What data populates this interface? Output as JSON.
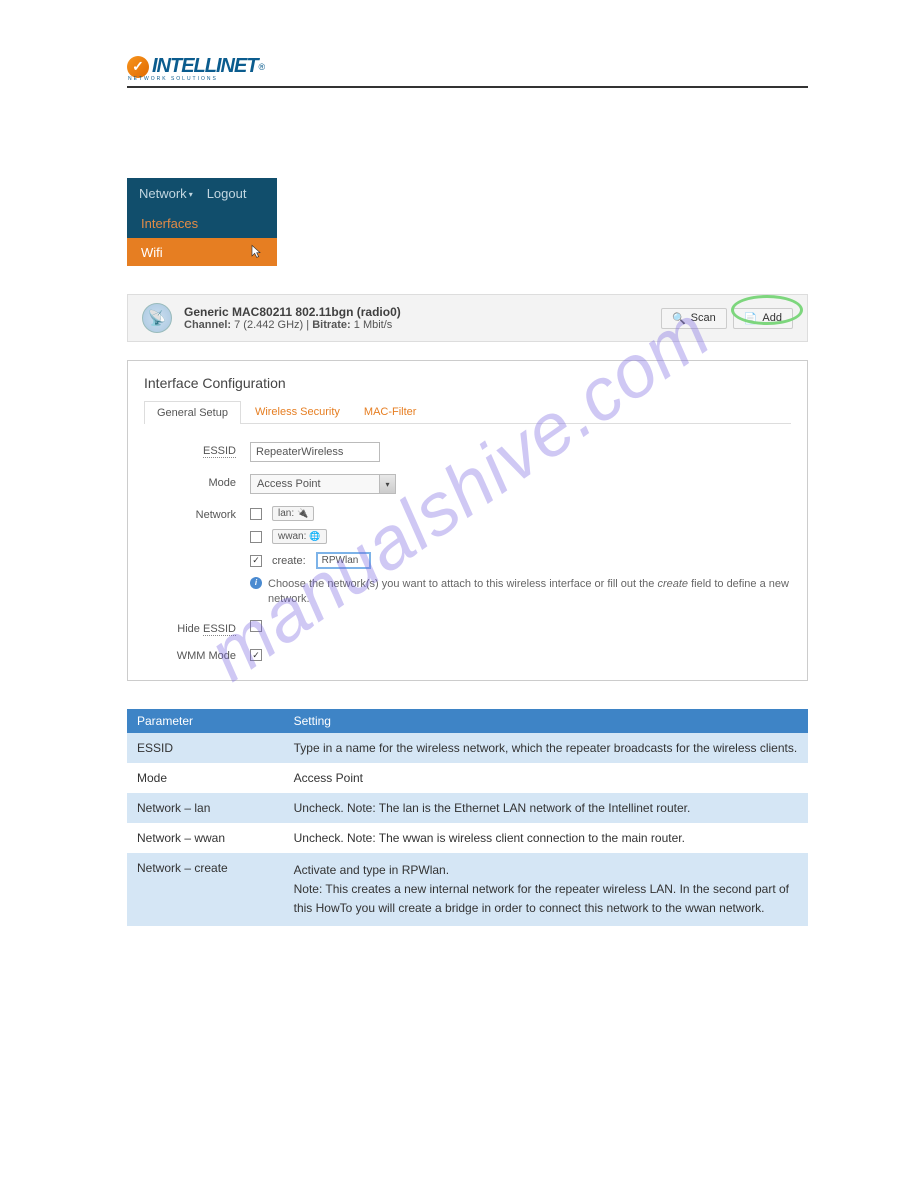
{
  "logo": {
    "brand": "INTELLINET",
    "subtitle": "NETWORK SOLUTIONS"
  },
  "nav": {
    "network_label": "Network",
    "logout_label": "Logout",
    "interfaces_label": "Interfaces",
    "wifi_label": "Wifi"
  },
  "radio": {
    "title": "Generic MAC80211 802.11bgn (radio0)",
    "channel_label": "Channel:",
    "channel_value": "7 (2.442 GHz)",
    "bitrate_label": "Bitrate:",
    "bitrate_value": "1 Mbit/s",
    "scan_label": "Scan",
    "add_label": "Add"
  },
  "iface": {
    "title": "Interface Configuration",
    "tabs": {
      "general": "General Setup",
      "security": "Wireless Security",
      "mac": "MAC-Filter"
    },
    "essid_label": "ESSID",
    "essid_value": "RepeaterWireless",
    "mode_label": "Mode",
    "mode_value": "Access Point",
    "network_label": "Network",
    "net_lan": "lan:",
    "net_wwan": "wwan:",
    "create_label": "create:",
    "create_value": "RPWlan",
    "help_text_a": "Choose the network(s) you want to attach to this wireless interface or fill out the ",
    "help_text_italic": "create",
    "help_text_b": " field to define a new network.",
    "hide_label": "Hide ",
    "hide_label_u": "ESSID",
    "wmm_label": "WMM Mode"
  },
  "table": {
    "h_param": "Parameter",
    "h_setting": "Setting",
    "rows": [
      {
        "param": "ESSID",
        "setting": "Type in a name for the wireless network, which the repeater broadcasts for the wireless clients."
      },
      {
        "param": "Mode",
        "setting": "Access Point"
      },
      {
        "param": "Network – lan",
        "setting": "Uncheck. Note: The lan is the Ethernet LAN network of the Intellinet router."
      },
      {
        "param": "Network – wwan",
        "setting": "Uncheck. Note: The wwan is wireless client connection to the main router."
      },
      {
        "param": "Network – create",
        "setting_a": "Activate and type in ",
        "setting_b": "RPWlan",
        "setting_c": ".",
        "setting_2": "Note: This creates a new internal network for the repeater wireless LAN. In the second part of this HowTo you will create a bridge in order to connect this network to the wwan network."
      }
    ]
  },
  "watermark": "manualshive.com"
}
